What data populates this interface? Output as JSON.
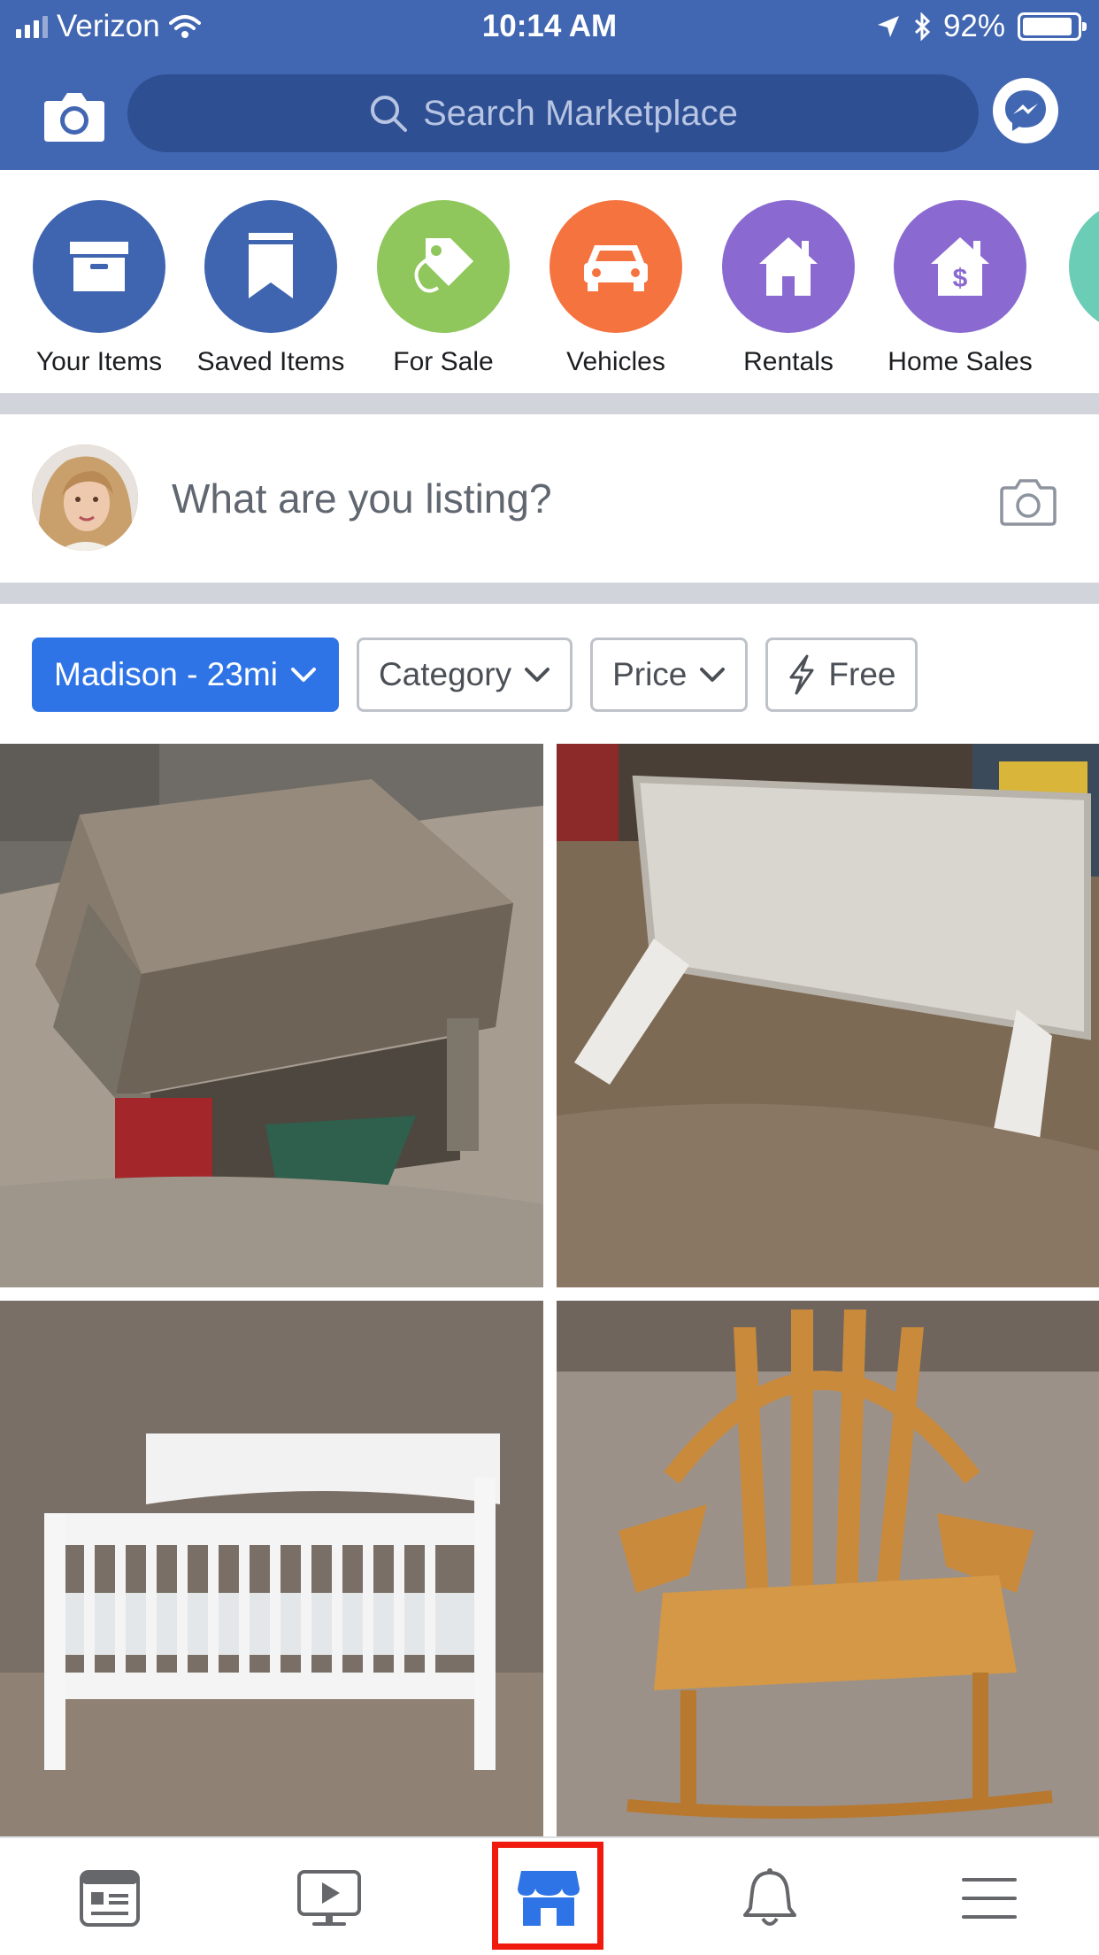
{
  "status_bar": {
    "carrier": "Verizon",
    "time": "10:14 AM",
    "battery": "92%",
    "battery_level": 0.92
  },
  "header": {
    "search_placeholder": "Search Marketplace",
    "icons": [
      "camera-icon",
      "search-icon",
      "messenger-icon"
    ],
    "brand_color": "#4267b2"
  },
  "categories": [
    {
      "label": "Your Items",
      "color": "#3f65b0",
      "icon": "box-icon"
    },
    {
      "label": "Saved Items",
      "color": "#3f65b0",
      "icon": "bookmark-icon"
    },
    {
      "label": "For Sale",
      "color": "#8fc75c",
      "icon": "tag-icon"
    },
    {
      "label": "Vehicles",
      "color": "#f5733f",
      "icon": "car-icon"
    },
    {
      "label": "Rentals",
      "color": "#8a6ad1",
      "icon": "house-icon"
    },
    {
      "label": "Home Sales",
      "color": "#8a6ad1",
      "icon": "house-dollar-icon"
    }
  ],
  "composer": {
    "prompt": "What are you listing?"
  },
  "filters": [
    {
      "label": "Madison - 23mi",
      "active": true
    },
    {
      "label": "Category",
      "active": false
    },
    {
      "label": "Price",
      "active": false
    },
    {
      "label": "Free",
      "active": false
    }
  ],
  "listings": [
    {
      "item": "coffee-table"
    },
    {
      "item": "bed-rail"
    },
    {
      "item": "crib"
    },
    {
      "item": "rocking-chair"
    }
  ],
  "bottom_nav": {
    "items": [
      "news-feed-icon",
      "watch-icon",
      "marketplace-icon",
      "notifications-icon",
      "menu-icon"
    ],
    "active": "marketplace-icon",
    "active_color": "#2f74e6",
    "highlight_color": "#f01a0f"
  }
}
